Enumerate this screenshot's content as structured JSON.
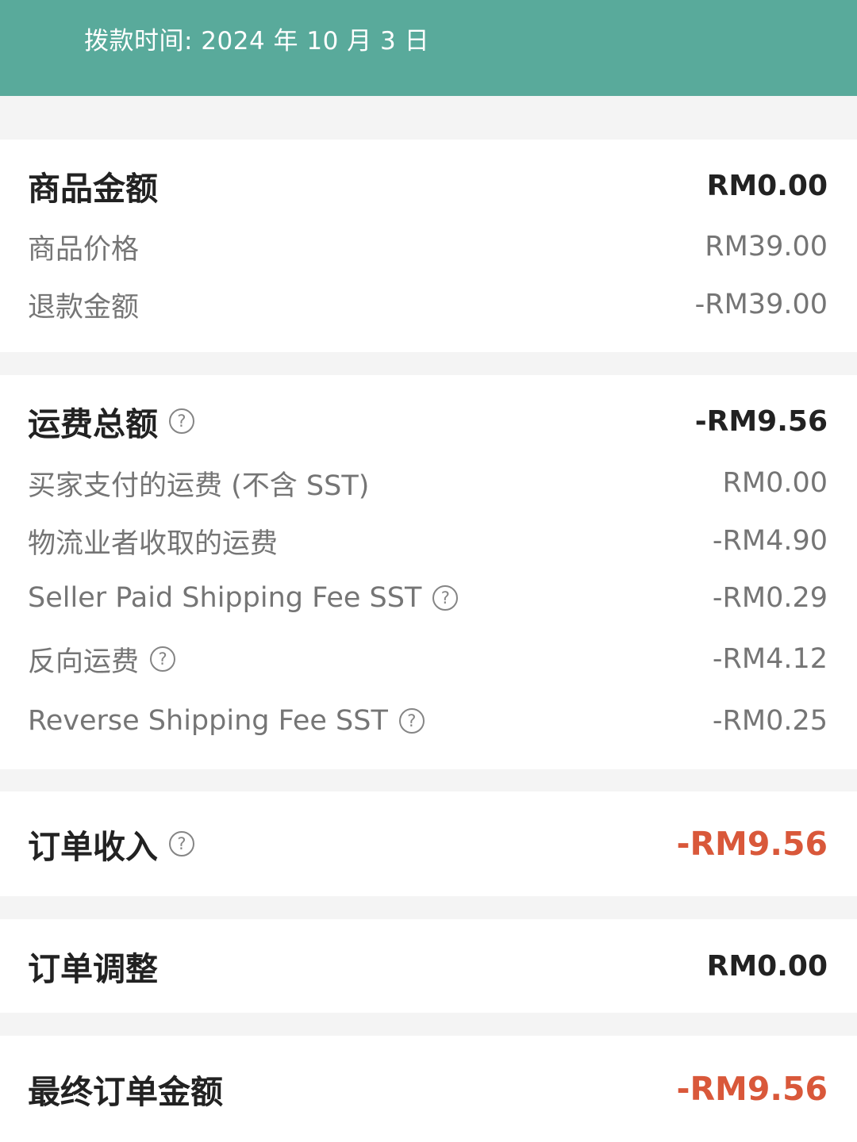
{
  "header": {
    "payout_time": "拨款时间: 2024 年 10 月 3 日"
  },
  "merchandise": {
    "title": "商品金额",
    "total": "RM0.00",
    "items": [
      {
        "label": "商品价格",
        "value": "RM39.00"
      },
      {
        "label": "退款金额",
        "value": "-RM39.00"
      }
    ]
  },
  "shipping": {
    "title": "运费总额",
    "total": "-RM9.56",
    "items": [
      {
        "label": "买家支付的运费 (不含 SST)",
        "value": "RM0.00"
      },
      {
        "label": "物流业者收取的运费",
        "value": "-RM4.90"
      },
      {
        "label": "Seller Paid Shipping Fee SST",
        "value": "-RM0.29"
      },
      {
        "label": "反向运费",
        "value": "-RM4.12"
      },
      {
        "label": "Reverse Shipping Fee SST",
        "value": "-RM0.25"
      }
    ]
  },
  "order_income": {
    "title": "订单收入",
    "value": "-RM9.56"
  },
  "order_adjustment": {
    "title": "订单调整",
    "value": "RM0.00"
  },
  "final_amount": {
    "title": "最终订单金额",
    "value": "-RM9.56"
  },
  "help_icon_glyph": "?",
  "colors": {
    "header_bg": "#59aa9b",
    "accent_negative": "#d9583a",
    "page_bg": "#f4f4f4"
  }
}
